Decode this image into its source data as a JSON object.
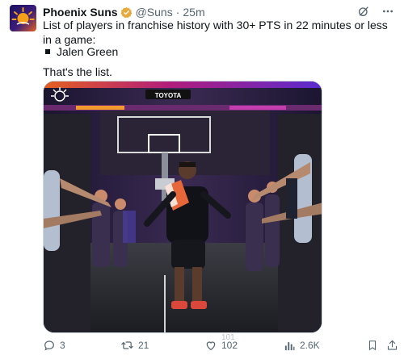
{
  "author": {
    "name": "Phoenix Suns",
    "handle": "@Suns",
    "separator": "·",
    "time": "25m",
    "verified": true
  },
  "tweet": {
    "text": "List of players in franchise history with 30+ PTS in 22 minutes or less in a game:",
    "list_items": [
      "Jalen Green"
    ],
    "closing": "That's the list."
  },
  "media": {
    "scoreboard_text": "TOYOTA"
  },
  "actions": {
    "reply_count": "3",
    "retweet_count": "21",
    "like_count": "102",
    "like_count_prev": "101",
    "views_count": "2.6K"
  },
  "colors": {
    "text_primary": "#0f1419",
    "text_secondary": "#536471",
    "verified_badge": "#e7a93b",
    "brand_purple": "#1d1160",
    "brand_orange": "#e56020"
  },
  "icons": {
    "verified": "verified-badge-icon",
    "grok": "grok-icon",
    "more": "more-icon",
    "reply": "reply-icon",
    "retweet": "retweet-icon",
    "like": "heart-icon",
    "views": "views-icon",
    "bookmark": "bookmark-icon",
    "share": "share-icon"
  }
}
